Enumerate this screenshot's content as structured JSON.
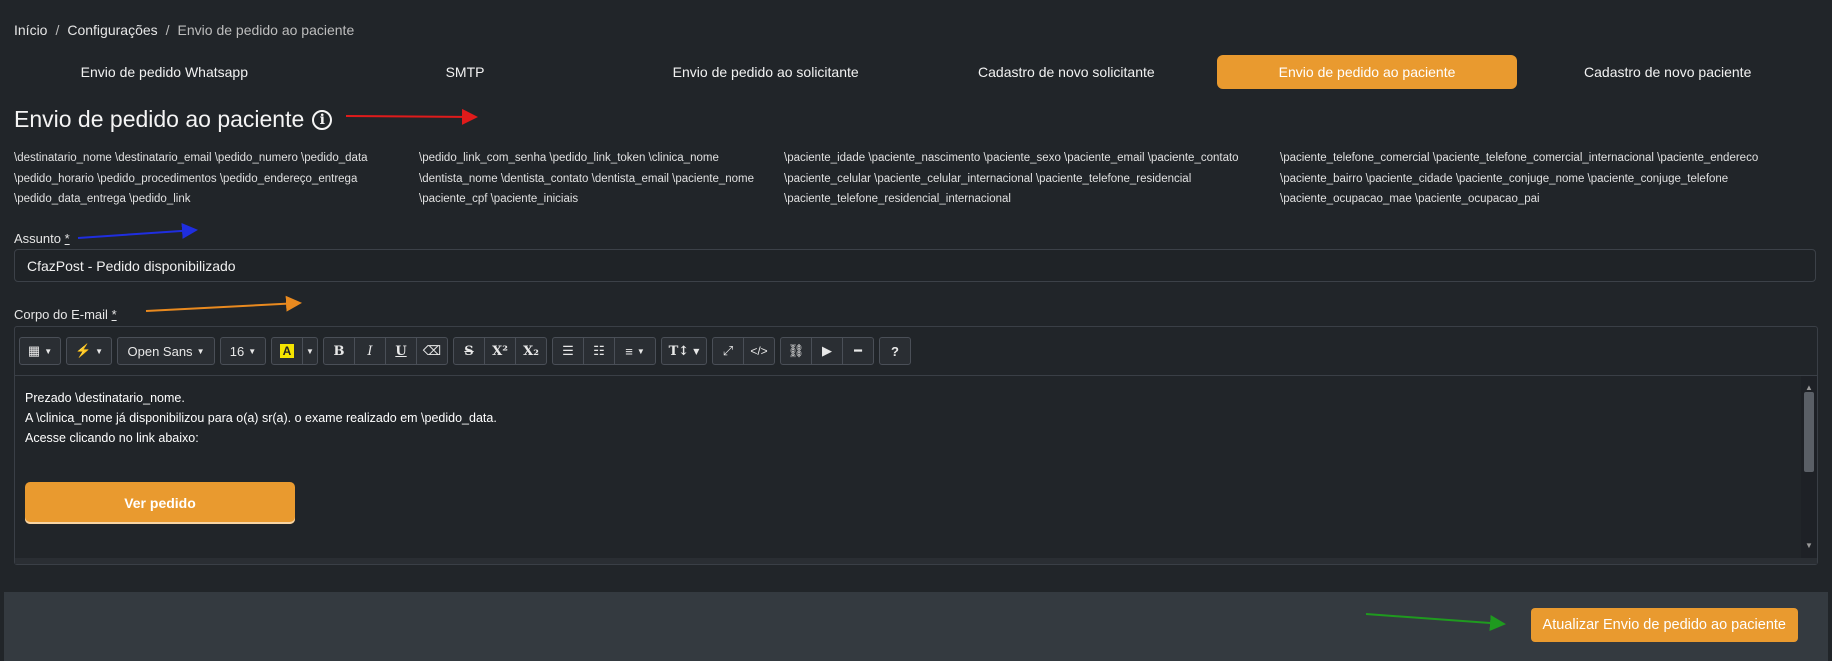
{
  "breadcrumb": {
    "home": "Início",
    "config": "Configurações",
    "current": "Envio de pedido ao paciente",
    "sep": "/"
  },
  "tabs": [
    {
      "label": "Envio de pedido Whatsapp"
    },
    {
      "label": "SMTP"
    },
    {
      "label": "Envio de pedido ao solicitante"
    },
    {
      "label": "Cadastro de novo solicitante"
    },
    {
      "label": "Envio de pedido ao paciente",
      "active": true
    },
    {
      "label": "Cadastro de novo paciente"
    }
  ],
  "page": {
    "title": "Envio de pedido ao paciente",
    "info_icon": "i"
  },
  "variables": {
    "col1": [
      "\\destinatario_nome \\destinatario_email \\pedido_numero \\pedido_data",
      "\\pedido_horario \\pedido_procedimentos \\pedido_endereço_entrega",
      "\\pedido_data_entrega \\pedido_link"
    ],
    "col2": [
      "\\pedido_link_com_senha \\pedido_link_token \\clinica_nome",
      "\\dentista_nome \\dentista_contato \\dentista_email \\paciente_nome",
      "\\paciente_cpf \\paciente_iniciais"
    ],
    "col3": [
      "\\paciente_idade \\paciente_nascimento \\paciente_sexo \\paciente_email \\paciente_contato",
      "\\paciente_celular \\paciente_celular_internacional \\paciente_telefone_residencial",
      "\\paciente_telefone_residencial_internacional"
    ],
    "col4": [
      "\\paciente_telefone_comercial \\paciente_telefone_comercial_internacional \\paciente_endereco",
      "\\paciente_bairro \\paciente_cidade \\paciente_conjuge_nome \\paciente_conjuge_telefone",
      "\\paciente_ocupacao_mae \\paciente_ocupacao_pai"
    ]
  },
  "subject": {
    "label": "Assunto",
    "required": "*",
    "value": "CfazPost - Pedido disponibilizado"
  },
  "body": {
    "label": "Corpo do E-mail",
    "required": "*",
    "toolbar": {
      "font": "Open Sans",
      "size": "16",
      "bold": "B",
      "italic": "I",
      "underline": "U",
      "strike": "S",
      "superscript": "X²",
      "subscript": "X₂",
      "fontsize_icon": "T↕",
      "code": "</>",
      "help": "?",
      "highlight": "A"
    },
    "lines": [
      "Prezado \\destinatario_nome.",
      "A \\clinica_nome já disponibilizou para o(a) sr(a). o exame realizado em \\pedido_data.",
      "Acesse clicando no link abaixo:"
    ],
    "button": "Ver pedido"
  },
  "footer": {
    "save_label": "Atualizar Envio de pedido ao paciente"
  },
  "colors": {
    "accent": "#e99a2f",
    "background": "#212529",
    "footer": "#343a40",
    "annotations": [
      "#e01b1b",
      "#1f2ee0",
      "#e98a1f",
      "#1f9a1f"
    ]
  }
}
